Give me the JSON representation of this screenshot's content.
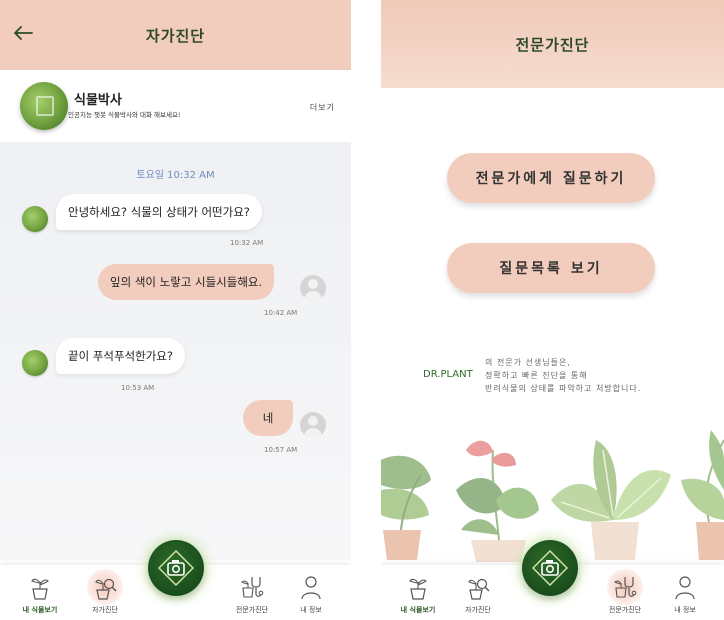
{
  "left_screen": {
    "title": "자가진단",
    "profile": {
      "name": "식물박사",
      "subtitle": "인공지능 챗봇 식물박사와 대화 해보세요!",
      "more_label": "더보기"
    },
    "date_label": "토요일 10:32 AM",
    "messages": [
      {
        "side": "in",
        "text": "안녕하세요? 식물의 상태가 어떤가요?",
        "time": "10:32 AM"
      },
      {
        "side": "out",
        "text": "잎의 색이 노랗고 시들시들해요.",
        "time": "10:42 AM"
      },
      {
        "side": "in",
        "text": "끝이 푸석푸석한가요?",
        "time": "10:53 AM"
      },
      {
        "side": "out",
        "text": "네",
        "time": "10:57 AM"
      }
    ]
  },
  "right_screen": {
    "title": "전문가진단",
    "ask_button": "전문가에게 질문하기",
    "list_button": "질문목록 보기",
    "brand": "DR.PLANT",
    "description": [
      "의 전문가 선생님들은,",
      "정확하고 빠른 진단을 통해",
      "반려식물의 상태를 파악하고 처방합니다."
    ]
  },
  "nav": {
    "items": [
      "내 식물보기",
      "자가진단",
      "전문가진단",
      "내 정보"
    ],
    "left_active": "자가진단",
    "right_active": "전문가진단"
  },
  "colors": {
    "header_pink": "#f2cdbd",
    "dark_green": "#1a4d1c",
    "text_green": "#2f5a28"
  },
  "icons": [
    "back-arrow-icon",
    "plant-pot-icon",
    "plant-search-icon",
    "camera-icon",
    "stethoscope-icon",
    "user-icon"
  ]
}
